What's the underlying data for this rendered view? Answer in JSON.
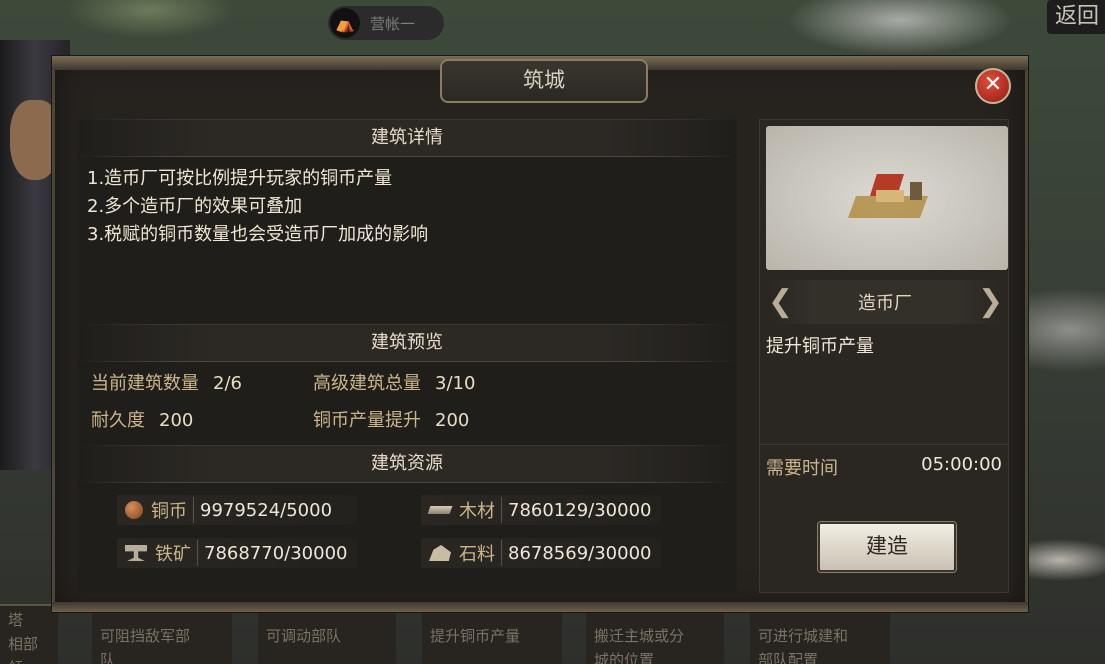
{
  "top": {
    "tag_label": "营帐一",
    "back_label": "返回"
  },
  "bottom_cards": [
    {
      "lines": [
        "塔",
        "相部领"
      ]
    },
    {
      "lines": [
        "可阻挡敌军部",
        "队"
      ]
    },
    {
      "lines": [
        "可调动部队"
      ]
    },
    {
      "lines": [
        "提升铜币产量"
      ]
    },
    {
      "lines": [
        "搬迁主城或分",
        "城的位置"
      ]
    },
    {
      "lines": [
        "可进行城建和",
        "部队配置"
      ]
    }
  ],
  "dialog": {
    "title": "筑城",
    "close_icon": "close-icon",
    "details": {
      "heading": "建筑详情",
      "items": [
        "1.造币厂可按比例提升玩家的铜币产量",
        "2.多个造币厂的效果可叠加",
        "3.税赋的铜币数量也会受造币厂加成的影响"
      ]
    },
    "preview_section": {
      "heading": "建筑预览",
      "current_count_label": "当前建筑数量",
      "current_count_value": "2/6",
      "senior_total_label": "高级建筑总量",
      "senior_total_value": "3/10",
      "durability_label": "耐久度",
      "durability_value": "200",
      "coin_boost_label": "铜币产量提升",
      "coin_boost_value": "200"
    },
    "resources": {
      "heading": "建筑资源",
      "coin": {
        "label": "铜币",
        "value": "9979524/5000",
        "icon": "coin-icon"
      },
      "wood": {
        "label": "木材",
        "value": "7860129/30000",
        "icon": "wood-icon"
      },
      "iron": {
        "label": "铁矿",
        "value": "7868770/30000",
        "icon": "iron-icon"
      },
      "stone": {
        "label": "石料",
        "value": "8678569/30000",
        "icon": "stone-icon"
      }
    },
    "building": {
      "name": "造币厂",
      "description": "提升铜币产量",
      "time_label": "需要时间",
      "time_value": "05:00:00",
      "build_label": "建造"
    }
  }
}
